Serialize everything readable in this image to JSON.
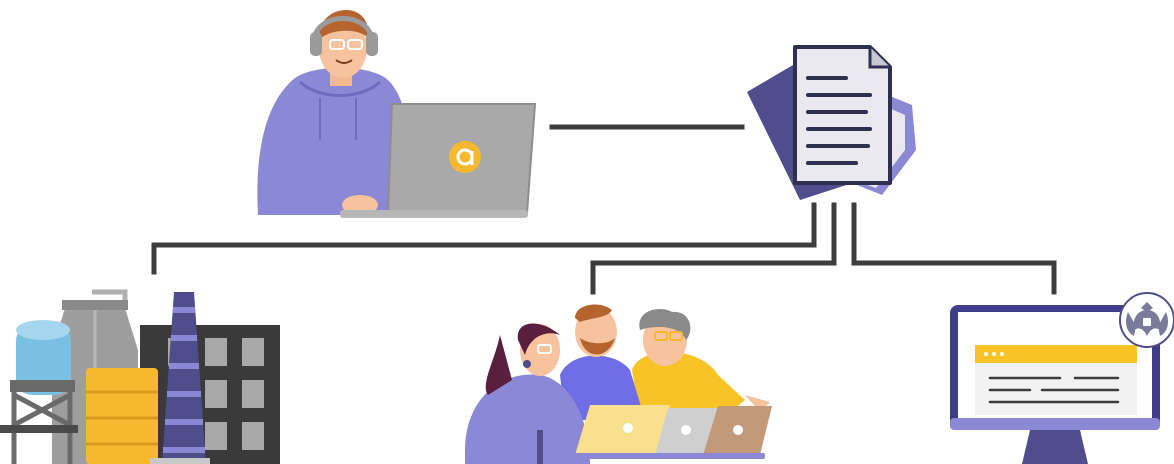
{
  "diagram": {
    "nodes": [
      {
        "id": "operator",
        "depicts": "person-with-headset-at-laptop",
        "logo": "letter-a-circle"
      },
      {
        "id": "documents",
        "depicts": "stack-of-documents"
      },
      {
        "id": "industry",
        "depicts": "factory-with-chimney-and-tanks"
      },
      {
        "id": "team",
        "depicts": "three-people-with-laptops"
      },
      {
        "id": "government",
        "depicts": "monitor-with-browser-and-emblem"
      }
    ],
    "edges": [
      {
        "from": "operator",
        "to": "documents"
      },
      {
        "from": "documents",
        "to": "industry"
      },
      {
        "from": "documents",
        "to": "team"
      },
      {
        "from": "documents",
        "to": "government"
      }
    ]
  },
  "colors": {
    "line": "#3d3d3d",
    "purple": "#8b88d6",
    "dark_purple": "#4f4d8c",
    "laptop_gray": "#a9a9a9",
    "yellow": "#f5b82e",
    "blue": "#7bbfe3",
    "building": "#3a3a3a"
  }
}
